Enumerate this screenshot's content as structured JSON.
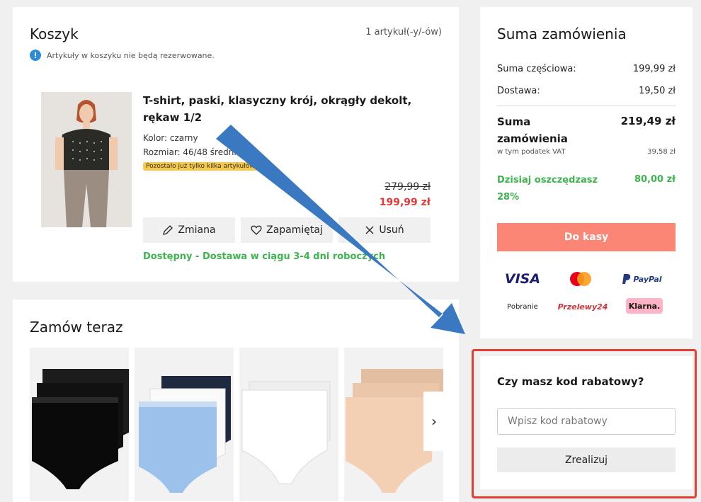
{
  "cart": {
    "title": "Koszyk",
    "count": "1 artykuł(-y/-ów)",
    "note": "Artykuły w koszyku nie będą rezerwowane.",
    "item": {
      "name": "T-shirt, paski, klasyczny krój, okrągły dekolt, rękaw 1/2",
      "color": "Kolor: czarny",
      "size": "Rozmiar: 46/48 średni",
      "stock_badge": "Pozostało już tylko kilka artykułów",
      "old_price": "279,99 zł",
      "new_price": "199,99 zł",
      "actions": {
        "change": "Zmiana",
        "save": "Zapamiętaj",
        "remove": "Usuń"
      },
      "availability": "Dostępny - Dostawa w ciągu 3-4 dni roboczych"
    }
  },
  "order_now": {
    "title": "Zamów teraz"
  },
  "summary": {
    "title": "Suma zamówienia",
    "subtotal_label": "Suma częściowa:",
    "subtotal_value": "199,99 zł",
    "shipping_label": "Dostawa:",
    "shipping_value": "19,50 zł",
    "total_label": "Suma zamówienia",
    "total_value": "219,49 zł",
    "vat_label": "w tym podatek VAT",
    "vat_value": "39,58 zł",
    "savings_label": "Dzisiaj oszczędzasz 28%",
    "savings_value": "80,00 zł",
    "checkout": "Do kasy",
    "payments": {
      "visa": "VISA",
      "paypal": "PayPal",
      "cod": "Pobranie",
      "przelewy": "Przelewy24",
      "klarna": "Klarna."
    }
  },
  "discount": {
    "title": "Czy masz kod rabatowy?",
    "placeholder": "Wpisz kod rabatowy",
    "button": "Zrealizuj"
  },
  "colors": {
    "accent": "#fb8675",
    "green": "#3fb34f",
    "price_red": "#e3393a",
    "highlight": "#e33e34",
    "arrow": "#3a78c2"
  }
}
